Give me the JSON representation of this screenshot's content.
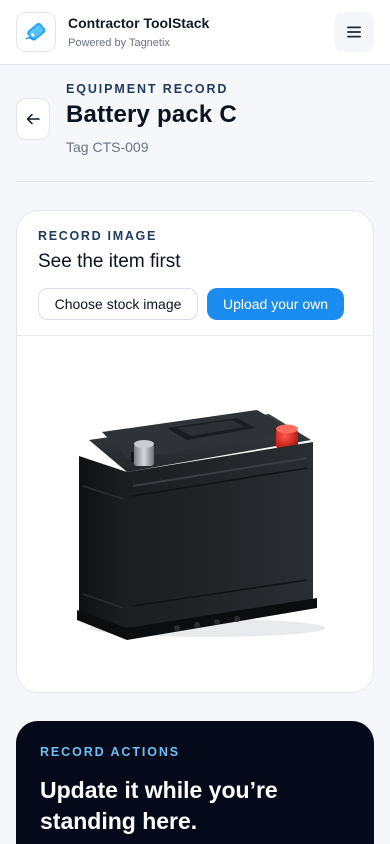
{
  "header": {
    "app_title": "Contractor ToolStack",
    "app_subtitle": "Powered by Tagnetix",
    "logo_icon": "tag-logo-icon",
    "menu_icon": "hamburger-menu-icon"
  },
  "record": {
    "eyebrow": "EQUIPMENT RECORD",
    "title": "Battery pack C",
    "tag": "Tag CTS-009",
    "back_icon": "arrow-left-icon"
  },
  "image_card": {
    "eyebrow": "RECORD IMAGE",
    "heading": "See the item first",
    "stock_button": "Choose stock image",
    "upload_button": "Upload your own",
    "image_subject": "car-battery-image"
  },
  "actions_card": {
    "eyebrow": "RECORD ACTIONS",
    "heading": "Update it while you’re standing here."
  },
  "colors": {
    "accent": "#1a8cf0",
    "navy_text": "#1e3a5f",
    "dark_card": "#040a1a",
    "actions_eyebrow": "#6cc0f5"
  }
}
